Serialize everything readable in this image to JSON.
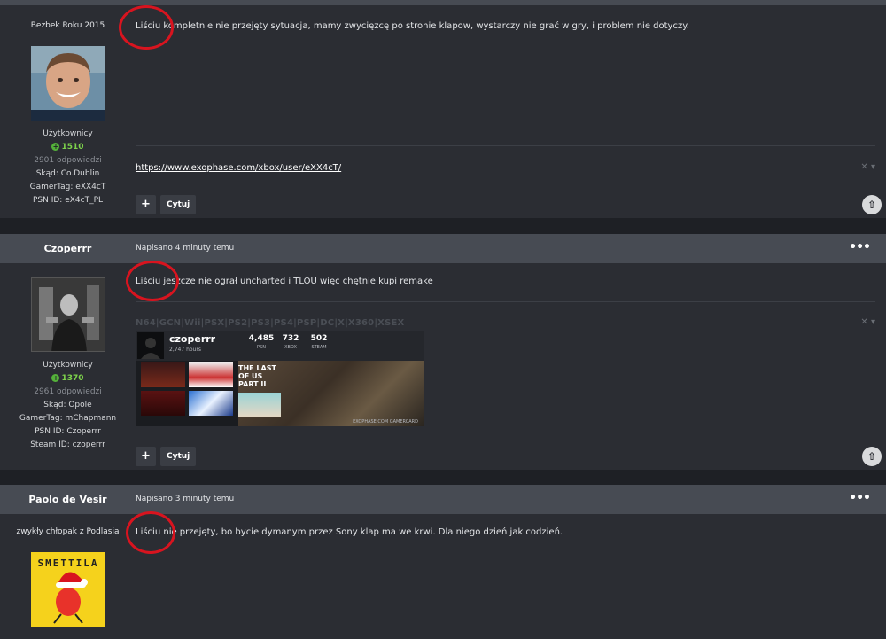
{
  "posts": [
    {
      "author_title": "Bezbek Roku 2015",
      "group": "Użytkownicy",
      "reputation": "1510",
      "replies": "2901 odpowiedzi",
      "meta": [
        "Skąd: Co.Dublin",
        "GamerTag: eXX4cT",
        "PSN ID: eX4cT_PL"
      ],
      "text": "Liściu kompletnie nie przejęty sytuacja, mamy zwycięzcę po stronie klapow, wystarczy nie grać w gry, i problem nie dotyczy.",
      "signature_link": "https://www.exophase.com/xbox/user/eXX4cT/",
      "signature_close": "✕ ▾",
      "quote_label": "Cytuj"
    },
    {
      "author": "Czoperrr",
      "date": "Napisano 4 minuty temu",
      "menu": "•••",
      "group": "Użytkownicy",
      "reputation": "1370",
      "replies": "2961 odpowiedzi",
      "meta": [
        "Skąd: Opole",
        "GamerTag: mChapmann",
        "PSN ID: Czoperrr",
        "Steam ID: czoperrr"
      ],
      "text": "Liściu jeszcze nie ograł uncharted i TLOU więc chętnie kupi remake",
      "signature_text": "N64|GCN|Wii|PSX|PS2|PS3|PS4|PSP|DC|X|X360|XSEX",
      "signature_close": "✕ ▾",
      "gamercard": {
        "name": "czoperrr",
        "hours": "2,747 hours",
        "stats": [
          {
            "value": "4,485",
            "label": "PSN"
          },
          {
            "value": "732",
            "label": "XBOX"
          },
          {
            "value": "502",
            "label": "STEAM"
          }
        ],
        "art_title": "THE LAST OF US PART II",
        "footer": "EXOPHASE.COM GAMERCARD"
      },
      "quote_label": "Cytuj"
    },
    {
      "author": "Paolo de Vesir",
      "date": "Napisano 3 minuty temu",
      "menu": "•••",
      "author_title": "zwykły chłopak z Podlasia",
      "text": "Liściu nie przejęty, bo bycie dymanym przez Sony klap ma we krwi. Dla niego dzień jak codzień.",
      "avatar_text": "SMETTILA"
    }
  ],
  "colors": {
    "background": "#1e2025",
    "post_bg": "#2b2d33",
    "header_bg": "#474b53",
    "reputation": "#7dd24b",
    "highlight_circle": "#d8141f"
  },
  "icons": {
    "plus": "+",
    "scroll_top": "⇧"
  }
}
